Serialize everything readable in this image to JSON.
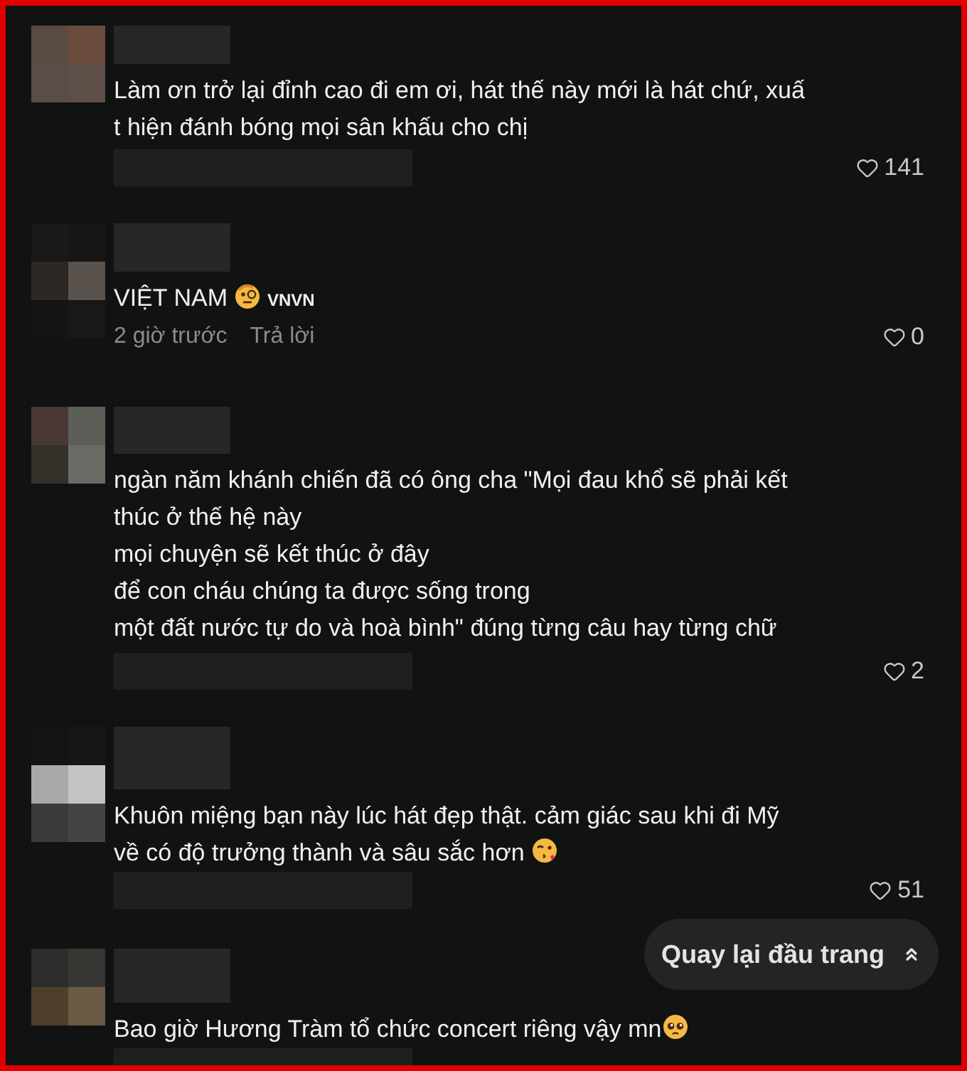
{
  "comments": [
    {
      "lines": [
        "Làm ơn trở lại đỉnh cao đi em ơi, hát thế này mới là hát chứ, xuấ",
        "t hiện đánh bóng mọi sân khấu cho chị"
      ],
      "likes": "141"
    },
    {
      "lines": [
        "VIỆT NAM"
      ],
      "emoji": {
        "kind": "monocle"
      },
      "suffix": "VNVN",
      "time": "2 giờ trước",
      "reply": "Trả lời",
      "likes": "0"
    },
    {
      "lines": [
        "ngàn năm khánh chiến đã có ông cha \"Mọi đau khổ sẽ phải kết",
        "thúc ở thế hệ này",
        "mọi chuyện sẽ kết thúc ở đây",
        "để con cháu chúng ta được sống trong",
        "một đất nước tự do và hoà bình\" đúng từng câu hay từng chữ"
      ],
      "likes": "2"
    },
    {
      "lines": [
        "Khuôn miệng bạn này lúc hát đẹp thật. cảm giác sau khi đi Mỹ",
        "về có độ trưởng thành và sâu sắc hơn"
      ],
      "emoji": {
        "kind": "kiss"
      },
      "likes": "51"
    },
    {
      "lines": [
        "Bao giờ Hương Tràm tổ chức concert riêng vậy mn"
      ],
      "emoji": {
        "kind": "pleading"
      }
    }
  ],
  "back_to_top": {
    "label": "Quay lại đầu trang"
  }
}
